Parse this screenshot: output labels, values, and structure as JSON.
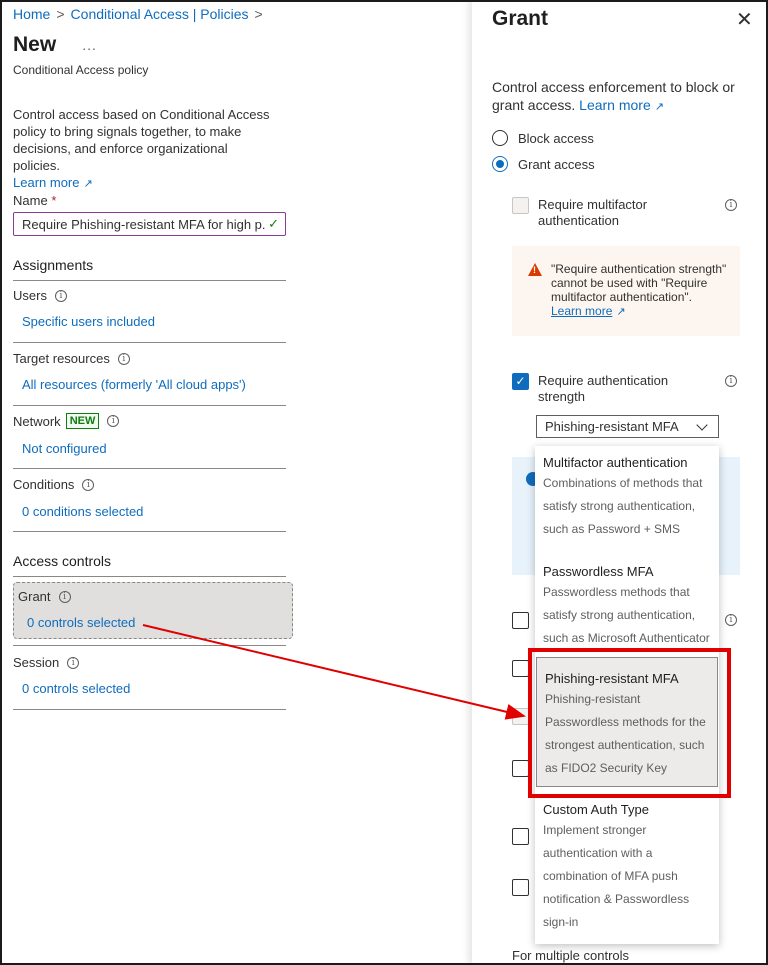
{
  "breadcrumb": {
    "home": "Home",
    "section": "Conditional Access | Policies"
  },
  "page": {
    "title": "New",
    "more": "...",
    "subtitle": "Conditional Access policy",
    "description": "Control access based on Conditional Access policy to bring signals together, to make decisions, and enforce organizational policies.",
    "learn_more": "Learn more"
  },
  "name_field": {
    "label": "Name",
    "required_mark": "*",
    "value": "Require Phishing-resistant MFA for high p..."
  },
  "assignments": {
    "heading": "Assignments",
    "users": {
      "label": "Users",
      "value": "Specific users included"
    },
    "target_resources": {
      "label": "Target resources",
      "value": "All resources (formerly 'All cloud apps')"
    },
    "network": {
      "label": "Network",
      "badge": "NEW",
      "value": "Not configured"
    },
    "conditions": {
      "label": "Conditions",
      "value": "0 conditions selected"
    }
  },
  "access_controls": {
    "heading": "Access controls",
    "grant": {
      "label": "Grant",
      "value": "0 controls selected"
    },
    "session": {
      "label": "Session",
      "value": "0 controls selected"
    }
  },
  "grant_panel": {
    "title": "Grant",
    "close": "✕",
    "description": "Control access enforcement to block or grant access.",
    "learn_more": "Learn more",
    "block_label": "Block access",
    "grant_label": "Grant access",
    "selected_mode": "grant",
    "mfa_label": "Require multifactor authentication",
    "warning_text": "\"Require authentication strength\" cannot be used with \"Require multifactor authentication\".",
    "warning_link": "Learn more",
    "auth_strength_label": "Require authentication strength",
    "auth_strength_checked": true,
    "auth_strength_value": "Phishing-resistant MFA",
    "footer_label": "For multiple controls"
  },
  "dropdown": {
    "options": [
      {
        "title": "Multifactor authentication",
        "desc": "Combinations of methods that satisfy strong authentication, such as Password + SMS",
        "selected": false
      },
      {
        "title": "Passwordless MFA",
        "desc": "Passwordless methods that satisfy strong authentication, such as Microsoft Authenticator",
        "selected": false
      },
      {
        "title": "Phishing-resistant MFA",
        "desc": "Phishing-resistant Passwordless methods for the strongest authentication, such as FIDO2 Security Key",
        "selected": true
      },
      {
        "title": "Custom Auth Type",
        "desc": "Implement stronger authentication with a combination of MFA push notification & Passwordless sign-in",
        "selected": false
      }
    ]
  },
  "icons": {
    "breadcrumb_chevron": "chevron-right-icon",
    "external": "external-link-icon",
    "info": "info-icon",
    "check": "checkmark-icon",
    "warning": "warning-icon",
    "close": "close-icon",
    "dropdown": "chevron-down-icon"
  },
  "colors": {
    "link": "#0f6cbd",
    "highlight": "#e00000",
    "warning": "#d83b01",
    "success": "#107c10"
  }
}
